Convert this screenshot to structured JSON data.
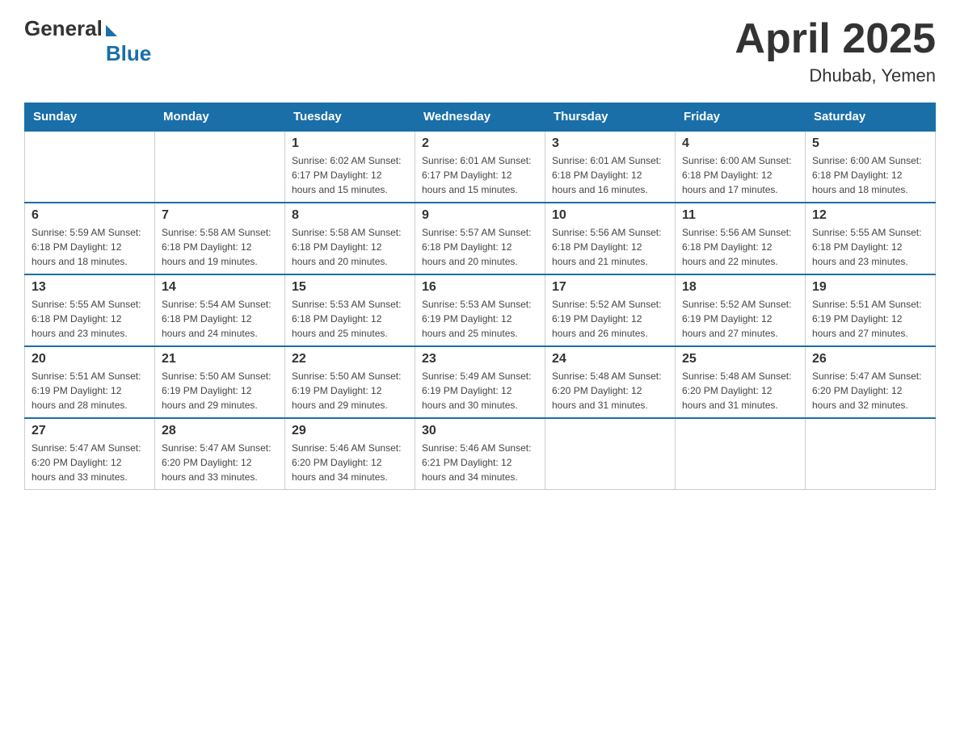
{
  "header": {
    "title": "April 2025",
    "location": "Dhubab, Yemen",
    "logo_general": "General",
    "logo_blue": "Blue"
  },
  "days_of_week": [
    "Sunday",
    "Monday",
    "Tuesday",
    "Wednesday",
    "Thursday",
    "Friday",
    "Saturday"
  ],
  "weeks": [
    [
      {
        "day": "",
        "info": ""
      },
      {
        "day": "",
        "info": ""
      },
      {
        "day": "1",
        "info": "Sunrise: 6:02 AM\nSunset: 6:17 PM\nDaylight: 12 hours\nand 15 minutes."
      },
      {
        "day": "2",
        "info": "Sunrise: 6:01 AM\nSunset: 6:17 PM\nDaylight: 12 hours\nand 15 minutes."
      },
      {
        "day": "3",
        "info": "Sunrise: 6:01 AM\nSunset: 6:18 PM\nDaylight: 12 hours\nand 16 minutes."
      },
      {
        "day": "4",
        "info": "Sunrise: 6:00 AM\nSunset: 6:18 PM\nDaylight: 12 hours\nand 17 minutes."
      },
      {
        "day": "5",
        "info": "Sunrise: 6:00 AM\nSunset: 6:18 PM\nDaylight: 12 hours\nand 18 minutes."
      }
    ],
    [
      {
        "day": "6",
        "info": "Sunrise: 5:59 AM\nSunset: 6:18 PM\nDaylight: 12 hours\nand 18 minutes."
      },
      {
        "day": "7",
        "info": "Sunrise: 5:58 AM\nSunset: 6:18 PM\nDaylight: 12 hours\nand 19 minutes."
      },
      {
        "day": "8",
        "info": "Sunrise: 5:58 AM\nSunset: 6:18 PM\nDaylight: 12 hours\nand 20 minutes."
      },
      {
        "day": "9",
        "info": "Sunrise: 5:57 AM\nSunset: 6:18 PM\nDaylight: 12 hours\nand 20 minutes."
      },
      {
        "day": "10",
        "info": "Sunrise: 5:56 AM\nSunset: 6:18 PM\nDaylight: 12 hours\nand 21 minutes."
      },
      {
        "day": "11",
        "info": "Sunrise: 5:56 AM\nSunset: 6:18 PM\nDaylight: 12 hours\nand 22 minutes."
      },
      {
        "day": "12",
        "info": "Sunrise: 5:55 AM\nSunset: 6:18 PM\nDaylight: 12 hours\nand 23 minutes."
      }
    ],
    [
      {
        "day": "13",
        "info": "Sunrise: 5:55 AM\nSunset: 6:18 PM\nDaylight: 12 hours\nand 23 minutes."
      },
      {
        "day": "14",
        "info": "Sunrise: 5:54 AM\nSunset: 6:18 PM\nDaylight: 12 hours\nand 24 minutes."
      },
      {
        "day": "15",
        "info": "Sunrise: 5:53 AM\nSunset: 6:18 PM\nDaylight: 12 hours\nand 25 minutes."
      },
      {
        "day": "16",
        "info": "Sunrise: 5:53 AM\nSunset: 6:19 PM\nDaylight: 12 hours\nand 25 minutes."
      },
      {
        "day": "17",
        "info": "Sunrise: 5:52 AM\nSunset: 6:19 PM\nDaylight: 12 hours\nand 26 minutes."
      },
      {
        "day": "18",
        "info": "Sunrise: 5:52 AM\nSunset: 6:19 PM\nDaylight: 12 hours\nand 27 minutes."
      },
      {
        "day": "19",
        "info": "Sunrise: 5:51 AM\nSunset: 6:19 PM\nDaylight: 12 hours\nand 27 minutes."
      }
    ],
    [
      {
        "day": "20",
        "info": "Sunrise: 5:51 AM\nSunset: 6:19 PM\nDaylight: 12 hours\nand 28 minutes."
      },
      {
        "day": "21",
        "info": "Sunrise: 5:50 AM\nSunset: 6:19 PM\nDaylight: 12 hours\nand 29 minutes."
      },
      {
        "day": "22",
        "info": "Sunrise: 5:50 AM\nSunset: 6:19 PM\nDaylight: 12 hours\nand 29 minutes."
      },
      {
        "day": "23",
        "info": "Sunrise: 5:49 AM\nSunset: 6:19 PM\nDaylight: 12 hours\nand 30 minutes."
      },
      {
        "day": "24",
        "info": "Sunrise: 5:48 AM\nSunset: 6:20 PM\nDaylight: 12 hours\nand 31 minutes."
      },
      {
        "day": "25",
        "info": "Sunrise: 5:48 AM\nSunset: 6:20 PM\nDaylight: 12 hours\nand 31 minutes."
      },
      {
        "day": "26",
        "info": "Sunrise: 5:47 AM\nSunset: 6:20 PM\nDaylight: 12 hours\nand 32 minutes."
      }
    ],
    [
      {
        "day": "27",
        "info": "Sunrise: 5:47 AM\nSunset: 6:20 PM\nDaylight: 12 hours\nand 33 minutes."
      },
      {
        "day": "28",
        "info": "Sunrise: 5:47 AM\nSunset: 6:20 PM\nDaylight: 12 hours\nand 33 minutes."
      },
      {
        "day": "29",
        "info": "Sunrise: 5:46 AM\nSunset: 6:20 PM\nDaylight: 12 hours\nand 34 minutes."
      },
      {
        "day": "30",
        "info": "Sunrise: 5:46 AM\nSunset: 6:21 PM\nDaylight: 12 hours\nand 34 minutes."
      },
      {
        "day": "",
        "info": ""
      },
      {
        "day": "",
        "info": ""
      },
      {
        "day": "",
        "info": ""
      }
    ]
  ]
}
